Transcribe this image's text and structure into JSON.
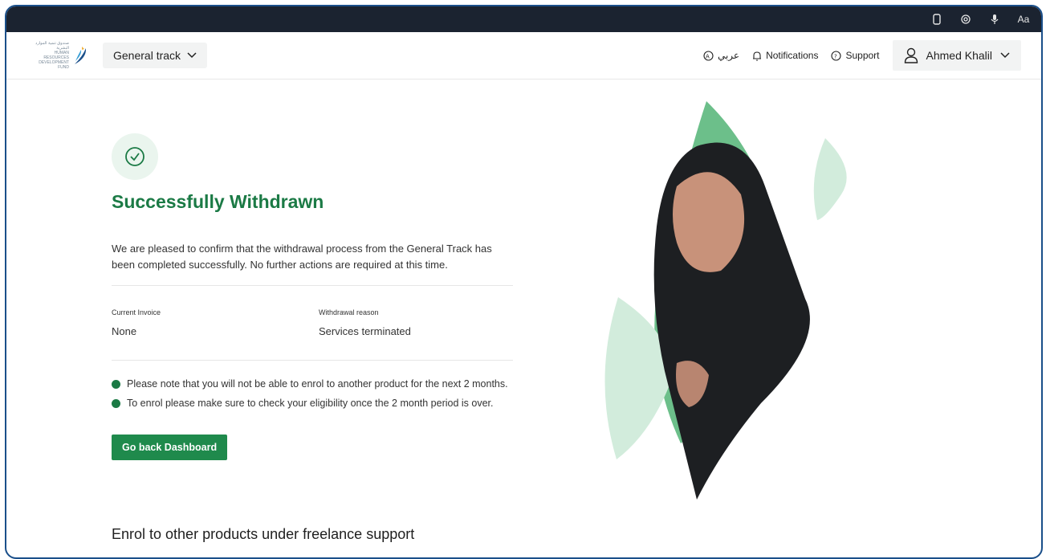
{
  "accessibility_bar": {
    "icons": [
      "phone-icon",
      "eye-icon",
      "mic-icon",
      "font-size-icon"
    ],
    "font_size_label": "Aa"
  },
  "header": {
    "logo_alt": "HUMAN RESOURCES DEVELOPMENT FUND",
    "logo_arabic": "صندوق تنمية الموارد البشرية",
    "track_selector": "General track",
    "language_link": "عربي",
    "notifications_link": "Notifications",
    "support_link": "Support",
    "user_name": "Ahmed Khalil"
  },
  "main": {
    "title": "Successfully Withdrawn",
    "description": "We are pleased to confirm that the withdrawal process from the General Track  has been completed successfully. No further actions are required at this time.",
    "fields": [
      {
        "label": "Current Invoice",
        "value": "None"
      },
      {
        "label": "Withdrawal reason",
        "value": "Services terminated"
      }
    ],
    "notes": [
      "Please note that you will not be able to enrol to another product for the next 2 months.",
      "To enrol please make sure to check your eligibility once the 2 month period is over."
    ],
    "cta_label": "Go back Dashboard",
    "section_title": "Enrol to other products under freelance support"
  },
  "colors": {
    "brand_green": "#1b7a45",
    "button_green": "#1f8a4c",
    "light_green": "#d2ecdc",
    "top_bar": "#1b2330",
    "frame_border": "#1a4f8a"
  }
}
